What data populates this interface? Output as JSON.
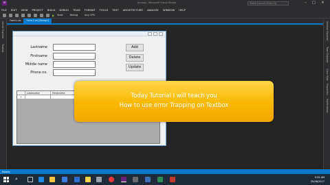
{
  "window": {
    "title": "Anurag - Microsoft Visual Studio",
    "quick_launch": "Quick Launch (Ctrl+Q)"
  },
  "menu": [
    "FILE",
    "EDIT",
    "VIEW",
    "PROJECT",
    "BUILD",
    "DEBUG",
    "TEAM",
    "FORMAT",
    "TOOLS",
    "TEST",
    "ARCHITECTURE",
    "ANALYZE",
    "WINDOW",
    "HELP"
  ],
  "toolbar": {
    "start_label": "Start",
    "config": "Debug",
    "platform": "Any CPU"
  },
  "left_panel": [
    "Server Explorer",
    "Toolbox"
  ],
  "right_panel": [
    "Solution Explorer",
    "Team Explorer",
    "Class View",
    "Properties",
    "Notifications"
  ],
  "tabs": [
    "Form1.vb",
    "Form1.vb [Design]"
  ],
  "form": {
    "labels": [
      "Lastname",
      "Firstname",
      "Middle name",
      "Phone no."
    ],
    "buttons": [
      "Add",
      "Delete",
      "Update"
    ],
    "grid_columns": [
      "Lastname",
      "Firstname"
    ],
    "grid_row_marker": "*"
  },
  "overlay": {
    "line1": "Today Tutorial I will teach you",
    "line2": "How to use error Trapping on Textbox"
  },
  "status": "Ready",
  "clock": {
    "time": "5:35 AM",
    "date": "25/06/2017"
  },
  "colors": {
    "accent": "#007acc",
    "overlay": "#f9b800",
    "ide_bg": "#2d2d30"
  }
}
